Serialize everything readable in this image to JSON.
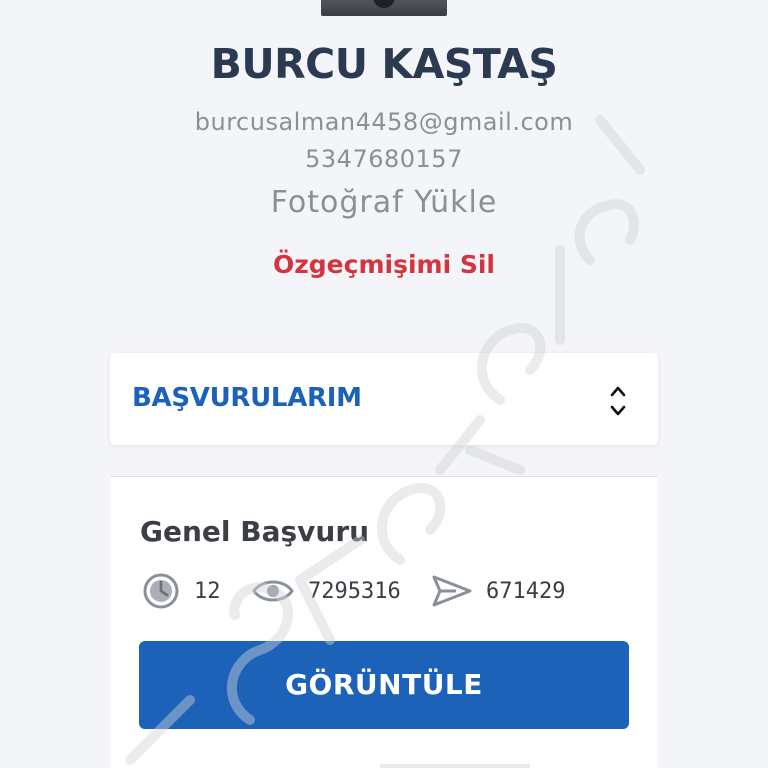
{
  "profile": {
    "name": "BURCU KAŞTAŞ",
    "email": "burcusalman4458@gmail.com",
    "phone": "5347680157",
    "upload_photo_label": "Fotoğraf Yükle",
    "delete_cv_label": "Özgeçmişimi Sil"
  },
  "applications": {
    "section_title": "BAŞVURULARIM",
    "card": {
      "title": "Genel Başvuru",
      "stats": {
        "time": "12",
        "views": "7295316",
        "sent": "671429"
      },
      "view_button_label": "GÖRÜNTÜLE"
    }
  },
  "colors": {
    "primary_blue": "#1c62b9",
    "danger_red": "#d4343e",
    "name_text": "#2b3a50",
    "muted_text": "#8b8f96",
    "background": "#f4f5f8"
  },
  "icons": [
    "clock-icon",
    "eye-icon",
    "send-icon",
    "chevron-up-down-icon"
  ]
}
